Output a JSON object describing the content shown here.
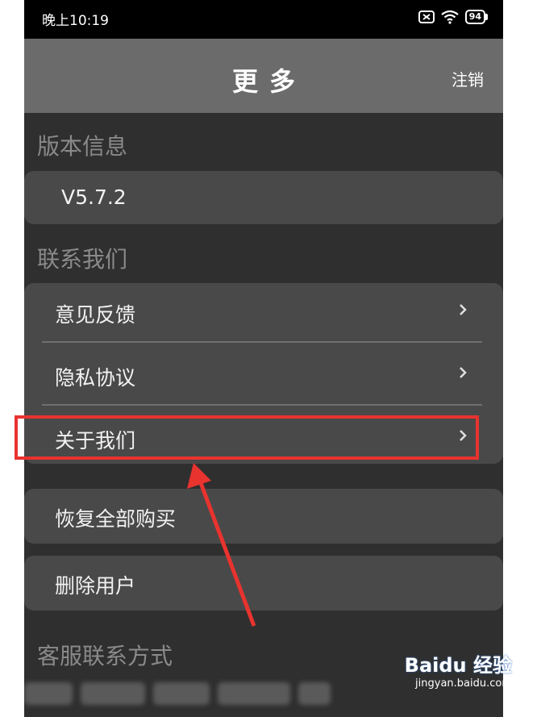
{
  "status": {
    "time": "晚上10:19",
    "battery": "94"
  },
  "header": {
    "title": "更多",
    "logout": "注销"
  },
  "sections": {
    "version": {
      "title": "版本信息",
      "value": "V5.7.2"
    },
    "contact": {
      "title": "联系我们",
      "items": [
        {
          "label": "意见反馈"
        },
        {
          "label": "隐私协议"
        },
        {
          "label": "关于我们"
        }
      ]
    },
    "restore": {
      "label": "恢复全部购买"
    },
    "delete_user": {
      "label": "删除用户"
    },
    "support": {
      "title": "客服联系方式"
    }
  },
  "watermark": {
    "brand": "Baidu 经验",
    "url": "jingyan.baidu.com"
  },
  "colors": {
    "highlight": "#e8332f",
    "background": "#2f2f2f",
    "header": "#6b6b6b",
    "card": "#494949"
  }
}
